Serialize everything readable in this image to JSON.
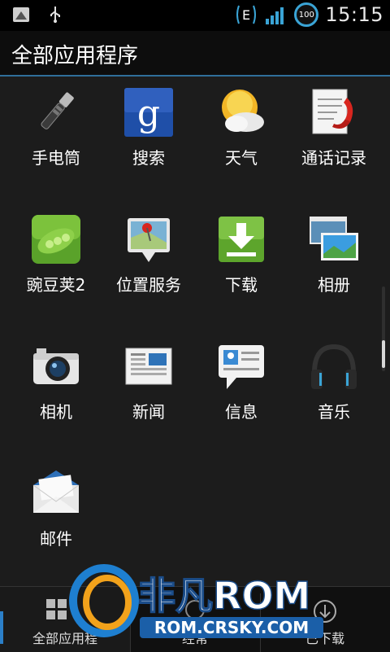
{
  "status_bar": {
    "time": "15:15",
    "battery": "100",
    "network": "E"
  },
  "header": {
    "title": "全部应用程序"
  },
  "apps": [
    {
      "label": "手电筒",
      "icon": "flashlight-icon"
    },
    {
      "label": "搜索",
      "icon": "google-search-icon"
    },
    {
      "label": "天气",
      "icon": "weather-icon"
    },
    {
      "label": "通话记录",
      "icon": "call-log-icon"
    },
    {
      "label": "豌豆荚2",
      "icon": "wandoujia-icon"
    },
    {
      "label": "位置服务",
      "icon": "location-service-icon"
    },
    {
      "label": "下载",
      "icon": "download-icon"
    },
    {
      "label": "相册",
      "icon": "gallery-icon"
    },
    {
      "label": "相机",
      "icon": "camera-icon"
    },
    {
      "label": "新闻",
      "icon": "news-icon"
    },
    {
      "label": "信息",
      "icon": "messages-icon"
    },
    {
      "label": "音乐",
      "icon": "music-icon"
    },
    {
      "label": "邮件",
      "icon": "mail-icon"
    }
  ],
  "tabs": [
    {
      "label": "全部应用程"
    },
    {
      "label": "经常"
    },
    {
      "label": "已下载"
    }
  ],
  "watermark": {
    "brand": "非凡ROM",
    "url": "ROM.CRSKY.COM"
  },
  "colors": {
    "accent": "#2f6f9a",
    "background": "#1c1c1c"
  }
}
